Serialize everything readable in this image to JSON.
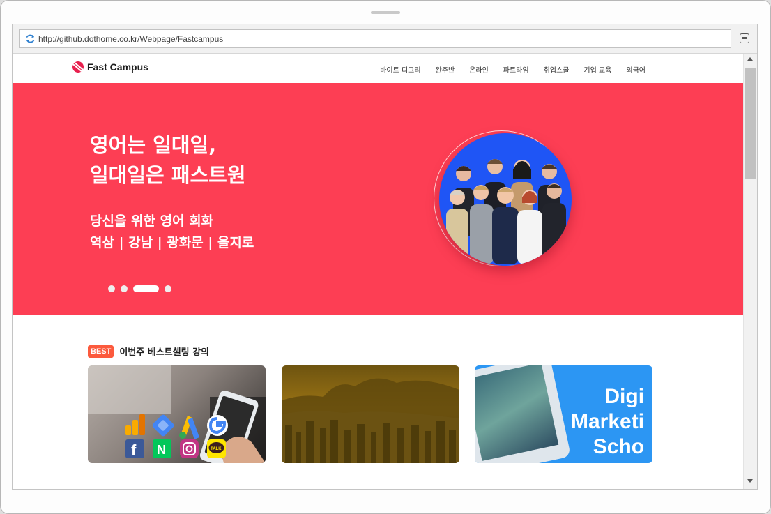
{
  "browser": {
    "url": "http://github.dothome.co.kr/Webpage/Fastcampus",
    "icons": {
      "refresh": "refresh-icon",
      "menu": "menu-icon"
    }
  },
  "header": {
    "logo_text": "Fast Campus",
    "nav": [
      "바이트 디그리",
      "완주반",
      "온라인",
      "파트타임",
      "취업스쿨",
      "기업 교육",
      "외국어"
    ]
  },
  "hero": {
    "title_line1": "영어는 일대일,",
    "title_line2": "일대일은 패스트원",
    "sub_line1": "당신을 위한 영어 회화",
    "sub_line2": "역삼 | 강남 | 광화문 | 을지로",
    "slides_total": 4,
    "active_slide": 3,
    "accent_color": "#fd3e54"
  },
  "bestsellers": {
    "badge": "BEST",
    "title": "이번주 베스트셀링 강의",
    "cards": [
      {
        "name": "marketing-course",
        "icons": [
          "google-analytics-icon",
          "google-tag-manager-icon",
          "google-ads-icon",
          "google-icon",
          "facebook-icon",
          "naver-icon",
          "instagram-icon",
          "kakaotalk-icon"
        ],
        "badge_text": "TALK"
      },
      {
        "name": "city-course"
      },
      {
        "name": "digital-marketing-course",
        "text_line1": "Digi",
        "text_line2": "Marketi",
        "text_line3": "Scho"
      }
    ]
  }
}
